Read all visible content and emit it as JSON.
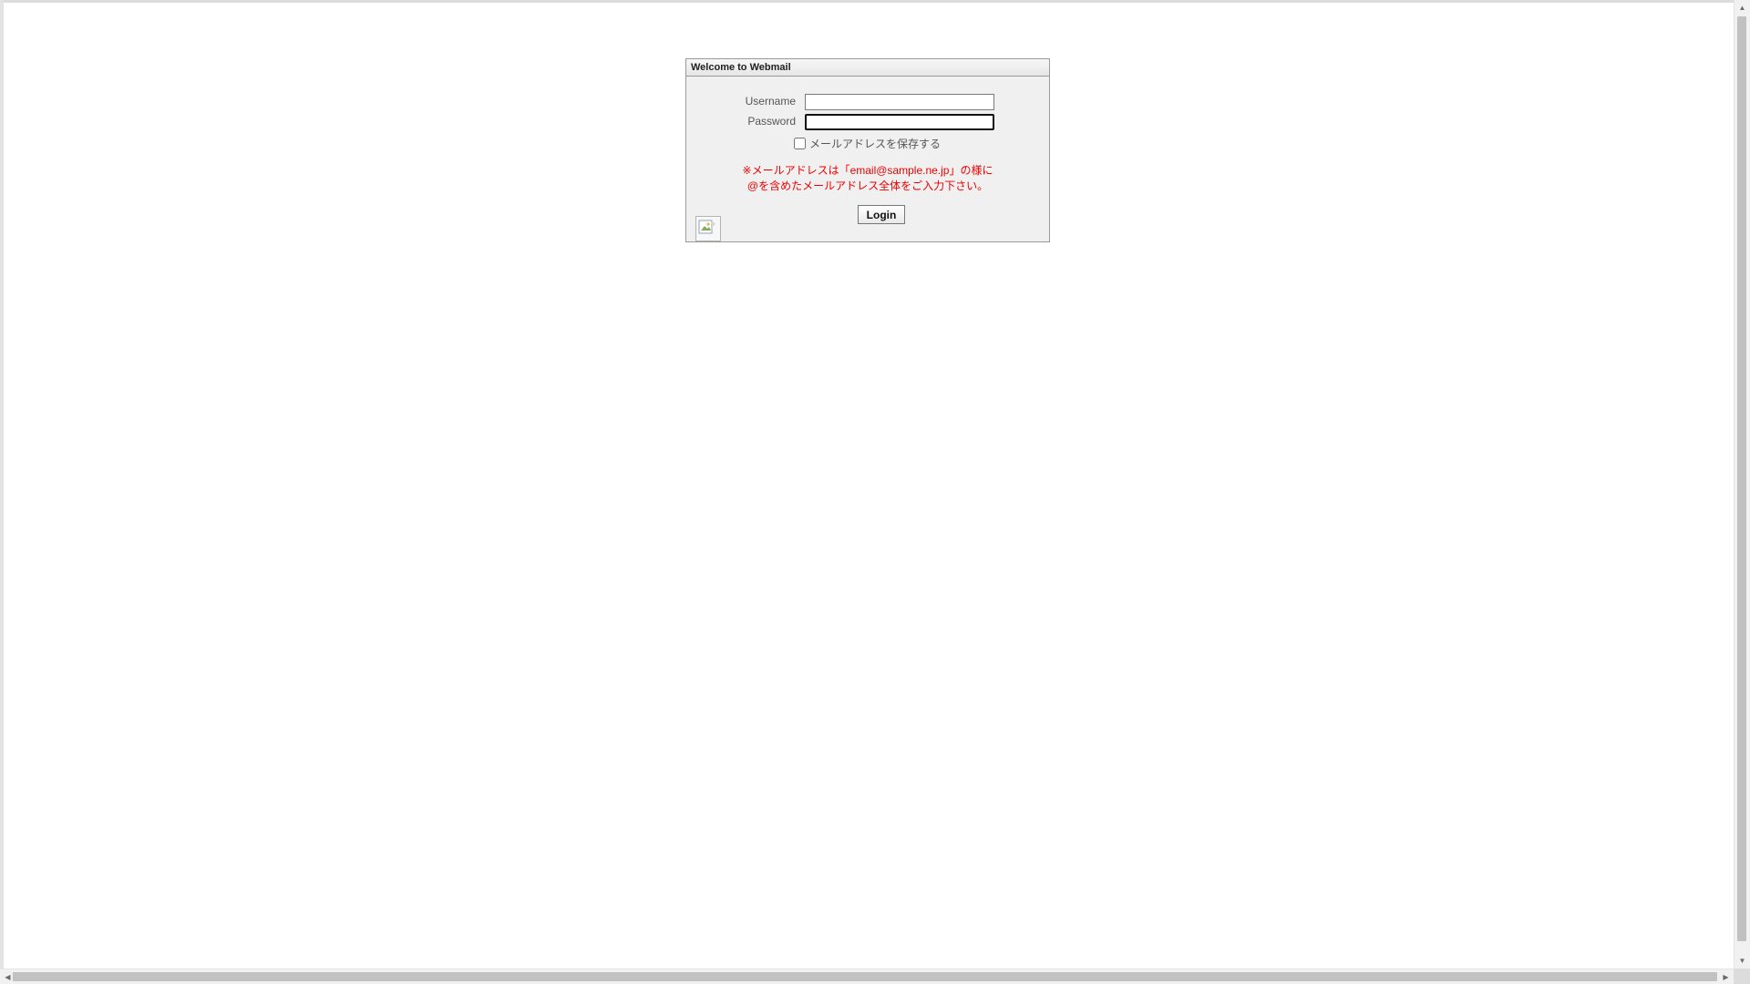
{
  "login": {
    "title": "Welcome to Webmail",
    "username_label": "Username",
    "username_value": "",
    "password_label": "Password",
    "password_value": "",
    "remember_label": "メールアドレスを保存する",
    "remember_checked": false,
    "notice_line1": "※メールアドレスは「email@sample.ne.jp」の様に",
    "notice_line2": "@を含めたメールアドレス全体をご入力下さい。",
    "login_button": "Login",
    "notice_color": "#ee0000"
  },
  "icons": {
    "logo": "broken-image-icon",
    "scroll_up": "arrow-up-icon",
    "scroll_down": "arrow-down-icon",
    "scroll_left": "arrow-left-icon",
    "scroll_right": "arrow-right-icon"
  }
}
